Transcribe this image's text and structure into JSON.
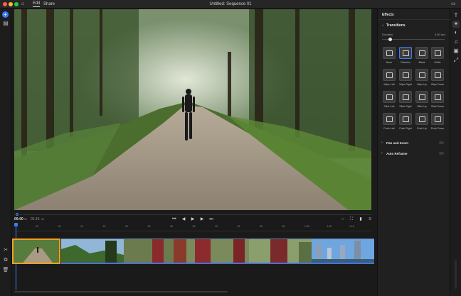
{
  "titlebar": {
    "menu_edit": "Edit",
    "menu_share": "Share",
    "title": "Untitled: Sequence 01"
  },
  "effects_panel": {
    "title": "Effects",
    "section_transitions": "Transitions",
    "duration_label": "Duration",
    "duration_value": "0.50 sec",
    "tiles": [
      "None",
      "Dissolve",
      "Black",
      "White",
      "Wipe Left",
      "Wipe Right",
      "Wipe Up",
      "Wipe Down",
      "Slide Left",
      "Slide Right",
      "Slide Up",
      "Slide Down",
      "Push Left",
      "Push Right",
      "Push Up",
      "Push Down"
    ],
    "selected_tile": "Dissolve",
    "section_pan_zoom": "Pan and Zoom",
    "section_auto_reframe": "Auto Reframe"
  },
  "timeline": {
    "current_time": "00:00",
    "current_frames": "00",
    "duration_time": "01:15",
    "duration_frames": "20",
    "ruler": [
      "00",
      "05",
      "10",
      "15",
      "20",
      "25",
      "30",
      "35",
      "40",
      "45",
      "50",
      "55",
      "1:00",
      "1:05",
      "1:10"
    ]
  },
  "colors": {
    "accent_blue": "#3c7bff",
    "clip_selection": "#f0a020",
    "panel_bg": "#202020",
    "app_bg": "#1b1b1b"
  }
}
